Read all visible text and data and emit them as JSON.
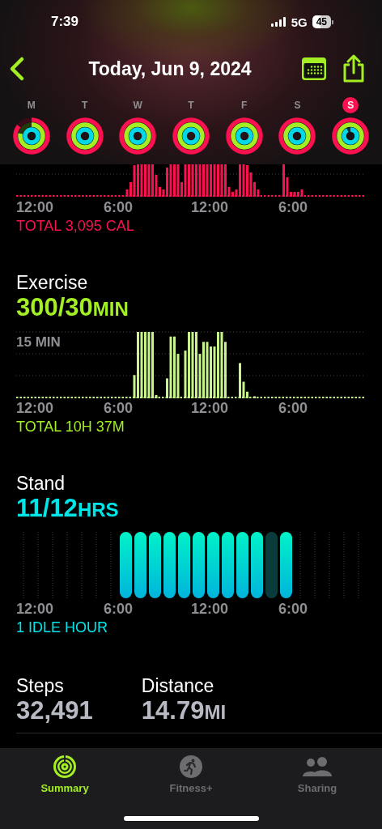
{
  "status_bar": {
    "time": "7:39",
    "network": "5G",
    "battery": "45"
  },
  "nav": {
    "title": "Today, Jun 9, 2024"
  },
  "days": [
    {
      "label": "M",
      "selected": false,
      "rings": [
        {
          "level": 0.85
        },
        {
          "level": 0.78
        },
        {
          "level": 1
        }
      ]
    },
    {
      "label": "T",
      "selected": false,
      "rings": [
        {
          "level": 1
        },
        {
          "level": 1
        },
        {
          "level": 1
        }
      ]
    },
    {
      "label": "W",
      "selected": false,
      "rings": [
        {
          "level": 1
        },
        {
          "level": 1
        },
        {
          "level": 1
        }
      ]
    },
    {
      "label": "T",
      "selected": false,
      "rings": [
        {
          "level": 1
        },
        {
          "level": 1
        },
        {
          "level": 1
        }
      ]
    },
    {
      "label": "F",
      "selected": false,
      "rings": [
        {
          "level": 1
        },
        {
          "level": 1
        },
        {
          "level": 1
        }
      ]
    },
    {
      "label": "S",
      "selected": false,
      "rings": [
        {
          "level": 1
        },
        {
          "level": 1
        },
        {
          "level": 1
        }
      ]
    },
    {
      "label": "S",
      "selected": true,
      "rings": [
        {
          "level": 1
        },
        {
          "level": 1
        },
        {
          "level": 0.92
        }
      ]
    }
  ],
  "move": {
    "axis": [
      "12:00",
      "6:00",
      "12:00",
      "6:00"
    ],
    "total": "TOTAL 3,095 CAL"
  },
  "exercise": {
    "title": "Exercise",
    "value": "300/30",
    "unit": "MIN",
    "gridline_label": "15 MIN",
    "axis": [
      "12:00",
      "6:00",
      "12:00",
      "6:00"
    ],
    "total": "TOTAL 10H 37M"
  },
  "stand": {
    "title": "Stand",
    "value": "11/12",
    "unit": "HRS",
    "hours": [
      {
        "kind": "none"
      },
      {
        "kind": "none"
      },
      {
        "kind": "none"
      },
      {
        "kind": "none"
      },
      {
        "kind": "none"
      },
      {
        "kind": "none"
      },
      {
        "kind": "none"
      },
      {
        "kind": "stood"
      },
      {
        "kind": "stood"
      },
      {
        "kind": "stood"
      },
      {
        "kind": "stood"
      },
      {
        "kind": "stood"
      },
      {
        "kind": "stood"
      },
      {
        "kind": "stood"
      },
      {
        "kind": "stood"
      },
      {
        "kind": "stood"
      },
      {
        "kind": "stood"
      },
      {
        "kind": "idle"
      },
      {
        "kind": "stood"
      },
      {
        "kind": "none"
      },
      {
        "kind": "none"
      },
      {
        "kind": "none"
      },
      {
        "kind": "none"
      },
      {
        "kind": "none"
      }
    ],
    "axis": [
      "12:00",
      "6:00",
      "12:00",
      "6:00"
    ],
    "total": "1 IDLE HOUR"
  },
  "stats": [
    {
      "label": "Steps",
      "value": "32,491"
    },
    {
      "label": "Distance",
      "value": "14.79",
      "unit": "MI"
    }
  ],
  "tabs": [
    {
      "label": "Summary",
      "selected": true,
      "kind": "rings"
    },
    {
      "label": "Fitness+",
      "selected": false,
      "kind": "runner"
    },
    {
      "label": "Sharing",
      "selected": false,
      "kind": "people"
    }
  ]
}
